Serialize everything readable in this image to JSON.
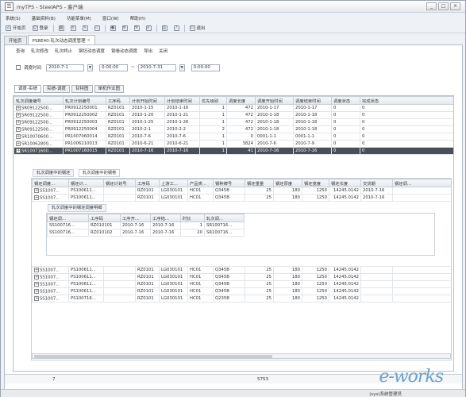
{
  "window": {
    "title": "myTPS - SteelAPS - 客户端",
    "controls": [
      "_",
      "□",
      "×"
    ]
  },
  "menu": [
    "系统(S)",
    "基础资料(B)",
    "功能菜单(M)",
    "窗口(W)",
    "帮助(H)"
  ],
  "toolbar": {
    "home": "开始页",
    "login": "登录",
    "logout": "退出"
  },
  "tabs": [
    {
      "label": "开始页"
    },
    {
      "label": "PSRE40-轧次动态调度管理"
    }
  ],
  "actions": [
    "查询",
    "轧次修改",
    "轧次终止",
    "钢坯动态调度",
    "钢卷动态调度",
    "导出",
    "关闭"
  ],
  "filter": {
    "label": "调度时间",
    "date_from": "2010-7-1",
    "time_from": "0:00:00",
    "date_to": "2010-7-31",
    "time_to": "0:00:00",
    "sep": "~"
  },
  "subtabs": [
    "调度-实绩",
    "实绩-调度",
    "甘特图",
    "单机作业图"
  ],
  "main_grid": {
    "columns": [
      "轧次调度编号",
      "轧次计划编号",
      "工序码",
      "计划开始时间",
      "计划结束时间",
      "优先级别",
      "调度长度",
      "调度开始时间",
      "调度结束时间",
      "调度状态",
      "完成状态"
    ],
    "rows": [
      [
        "SR09122500...",
        "PR0912250001",
        "RZ0101",
        "2010-1-15",
        "2010-1-16",
        "1",
        "472",
        "2010-1-17",
        "2010-1-17",
        "0",
        "0"
      ],
      [
        "SR09122500...",
        "PR0912250002",
        "RZ0101",
        "2010-1-20",
        "2010-1-21",
        "1",
        "472",
        "2010-1-18",
        "2010-1-18",
        "0",
        "0"
      ],
      [
        "SR09122500...",
        "PR0912250003",
        "RZ0101",
        "2010-1-25",
        "2010-1-26",
        "1",
        "472",
        "2010-1-18",
        "2010-1-18",
        "0",
        "0"
      ],
      [
        "SR09122500...",
        "PR0912250004",
        "RZ0101",
        "2010-2-1",
        "2010-2-2",
        "2",
        "472",
        "2010-1-18",
        "2010-1-18",
        "0",
        "0"
      ],
      [
        "SR10070600...",
        "PR1007060014",
        "RZ0101",
        "2010-7-6",
        "2010-7-6",
        "1",
        "0",
        "0001-1-1",
        "0001-1-1",
        "0",
        "0"
      ],
      [
        "SR10062800...",
        "PR1006210013",
        "RZ0101",
        "2010-6-21",
        "2010-6-21",
        "1",
        "3824",
        "2010-7-6",
        "2010-7-9",
        "0",
        "0"
      ],
      [
        "SR10071600...",
        "PR1007160015",
        "RZ0101",
        "2010-7-16",
        "2010-7-16",
        "1",
        "41",
        "2010-7-16",
        "2010-7-16",
        "0",
        "0"
      ]
    ],
    "selected_row": 6
  },
  "slab_grid": {
    "tab_a": "轧次调度中的钢坯",
    "tab_b": "轧次调度中的钢卷",
    "columns": [
      "钢坯调度...",
      "钢坯计...",
      "钢坯计划号",
      "工序码",
      "上游工...",
      "产品类...",
      "钢种牌号",
      "钢坯重量",
      "钢坯厚度",
      "钢坯宽度",
      "钢坯长度",
      "交货期",
      "钢坯调..."
    ],
    "rows": [
      [
        "SS1007...",
        "PS100611...",
        "",
        "RZ0101",
        "LG030101",
        "HC01",
        "Q345B",
        "25",
        "180",
        "1250",
        "14245.0142",
        "2010-7-16",
        ""
      ],
      [
        "SS1007...",
        "PS100611...",
        "",
        "RZ0101",
        "LG030101",
        "HC01",
        "Q345B",
        "25",
        "180",
        "1250",
        "14245.0142",
        "2010-7-16",
        ""
      ]
    ],
    "rows_after": [
      [
        "SS1007...",
        "PS100611...",
        "",
        "RZ0101",
        "LG030101",
        "HC01",
        "Q345B",
        "25",
        "180",
        "1250",
        "14245.0142",
        "",
        ""
      ],
      [
        "SS1007...",
        "PS100611...",
        "",
        "RZ0101",
        "LG030101",
        "HC01",
        "Q345B",
        "25",
        "180",
        "1250",
        "14245.0142",
        "",
        ""
      ],
      [
        "SS1007...",
        "PS100611...",
        "",
        "RZ0101",
        "LG030101",
        "HC01",
        "Q345B",
        "25",
        "180",
        "1250",
        "14245.0142",
        "",
        ""
      ],
      [
        "SS1007...",
        "PS100611...",
        "",
        "RZ0101",
        "LG030101",
        "HC01",
        "Q345B",
        "25",
        "180",
        "1250",
        "14245.0142",
        "",
        ""
      ],
      [
        "SS1007...",
        "PS100716...",
        "",
        "RZ0101",
        "LG030101",
        "HC01",
        "Q235B",
        "25",
        "180",
        "1250",
        "14245.0142",
        "",
        ""
      ]
    ]
  },
  "roll_grid": {
    "tab": "轧次调度中的钢坯调度明细",
    "columns": [
      "钢坯调...",
      "工序码",
      "工序开...",
      "工序结...",
      "时长",
      "轧次调..."
    ],
    "rows": [
      [
        "SS100716...",
        "RZ010101",
        "2010-7-16",
        "2010-7-16",
        "1",
        "SR100716..."
      ],
      [
        "SS100716...",
        "RZ010102",
        "2010-7-16",
        "2010-7-16",
        "20",
        "SR100716..."
      ]
    ]
  },
  "footer": {
    "count": "7",
    "sum": "5753"
  },
  "statusbar": {
    "text": "(sys)系统管理员"
  },
  "watermark": "e-works",
  "colors": {
    "selected_row": "#4a4f57",
    "header": "#e4e8ed",
    "accent": "#6aa1c9"
  }
}
